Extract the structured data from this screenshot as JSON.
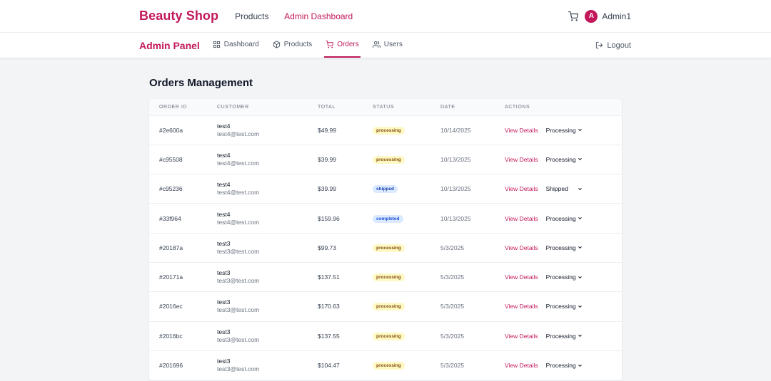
{
  "header": {
    "brand": "Beauty Shop",
    "nav": [
      {
        "label": "Products",
        "active": false
      },
      {
        "label": "Admin Dashboard",
        "active": true
      }
    ],
    "avatar_initial": "A",
    "username": "Admin1"
  },
  "admin_bar": {
    "title": "Admin Panel",
    "tabs": [
      {
        "label": "Dashboard",
        "icon": "grid-icon"
      },
      {
        "label": "Products",
        "icon": "box-icon"
      },
      {
        "label": "Orders",
        "icon": "cart-icon",
        "active": true
      },
      {
        "label": "Users",
        "icon": "users-icon"
      }
    ],
    "logout_label": "Logout"
  },
  "main": {
    "title": "Orders Management",
    "columns": [
      "ORDER ID",
      "CUSTOMER",
      "TOTAL",
      "STATUS",
      "DATE",
      "ACTIONS"
    ],
    "view_label": "View Details",
    "orders": [
      {
        "id": "#2e600a",
        "name": "test4",
        "email": "test4@test.com",
        "total": "$49.99",
        "status": "processing",
        "date": "10/14/2025",
        "select": "Processing"
      },
      {
        "id": "#c95508",
        "name": "test4",
        "email": "test4@test.com",
        "total": "$39.99",
        "status": "processing",
        "date": "10/13/2025",
        "select": "Processing"
      },
      {
        "id": "#c95236",
        "name": "test4",
        "email": "test4@test.com",
        "total": "$39.99",
        "status": "shipped",
        "date": "10/13/2025",
        "select": "Shipped"
      },
      {
        "id": "#33f964",
        "name": "test4",
        "email": "test4@test.com",
        "total": "$159.96",
        "status": "completed",
        "date": "10/13/2025",
        "select": "Processing"
      },
      {
        "id": "#20187a",
        "name": "test3",
        "email": "test3@test.com",
        "total": "$99.73",
        "status": "processing",
        "date": "5/3/2025",
        "select": "Processing"
      },
      {
        "id": "#20171a",
        "name": "test3",
        "email": "test3@test.com",
        "total": "$137.51",
        "status": "processing",
        "date": "5/3/2025",
        "select": "Processing"
      },
      {
        "id": "#2016ec",
        "name": "test3",
        "email": "test3@test.com",
        "total": "$170.63",
        "status": "processing",
        "date": "5/3/2025",
        "select": "Processing"
      },
      {
        "id": "#2016bc",
        "name": "test3",
        "email": "test3@test.com",
        "total": "$137.55",
        "status": "processing",
        "date": "5/3/2025",
        "select": "Processing"
      },
      {
        "id": "#201696",
        "name": "test3",
        "email": "test3@test.com",
        "total": "$104.47",
        "status": "processing",
        "date": "5/3/2025",
        "select": "Processing"
      }
    ]
  },
  "colors": {
    "brand": "#c2185b",
    "processing_bg": "#fef9c3",
    "shipped_bg": "#dbeafe"
  }
}
